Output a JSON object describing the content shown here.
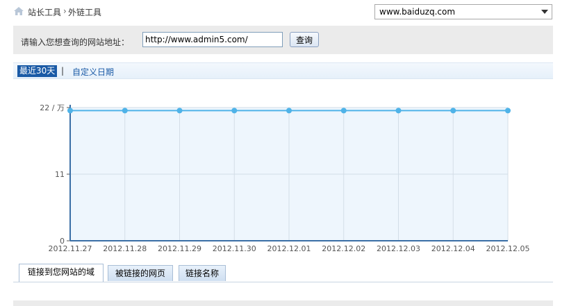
{
  "breadcrumb": {
    "home_label": "站长工具",
    "separator": "›",
    "current": "外链工具"
  },
  "site_select": {
    "selected": "www.baiduzq.com"
  },
  "query": {
    "label": "请输入您想查询的网站地址：",
    "url_value": "http://www.admin5.com/",
    "button_label": "查询"
  },
  "range": {
    "active_label": "最近30天",
    "separator": "|",
    "custom_label": "自定义日期"
  },
  "chart_data": {
    "type": "line",
    "x": [
      "2012.11.27",
      "2012.11.28",
      "2012.11.29",
      "2012.11.30",
      "2012.12.01",
      "2012.12.02",
      "2012.12.03",
      "2012.12.04",
      "2012.12.05"
    ],
    "series": [
      {
        "values": [
          21.5,
          21.5,
          21.5,
          21.5,
          21.5,
          21.5,
          21.5,
          21.5,
          21.5
        ]
      }
    ],
    "yticks": [
      "0",
      "11",
      "22 / 万"
    ],
    "ylim": [
      0,
      22
    ],
    "grid": true,
    "line_color": "#4fb3e8",
    "fill_color": "#eef6fd"
  },
  "tabs": [
    {
      "label": "链接到您网站的域"
    },
    {
      "label": "被链接的网页"
    },
    {
      "label": "链接名称"
    }
  ]
}
